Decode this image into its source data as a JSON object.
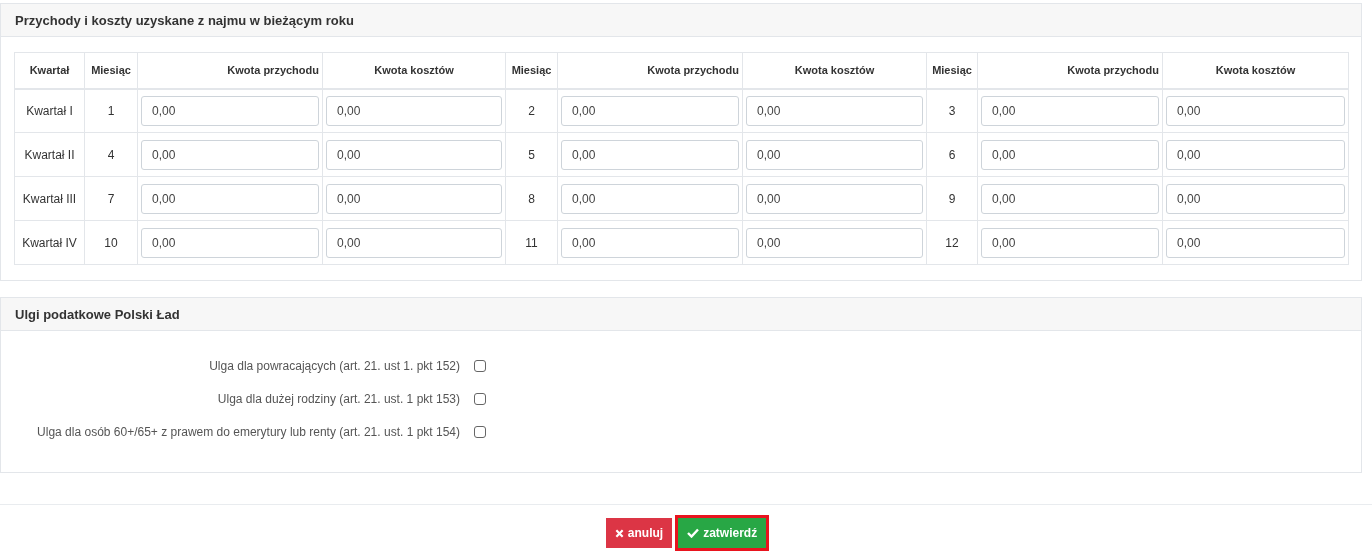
{
  "income_panel": {
    "title": "Przychody i koszty uzyskane z najmu w bieżącym roku",
    "columns": [
      "Kwartał",
      "Miesiąc",
      "Kwota przychodu",
      "Kwota kosztów",
      "Miesiąc",
      "Kwota przychodu",
      "Kwota kosztów",
      "Miesiąc",
      "Kwota przychodu",
      "Kwota kosztów"
    ],
    "rows": [
      {
        "quarter": "Kwartał I",
        "months": [
          {
            "month": "1",
            "income": "0,00",
            "costs": "0,00"
          },
          {
            "month": "2",
            "income": "0,00",
            "costs": "0,00"
          },
          {
            "month": "3",
            "income": "0,00",
            "costs": "0,00"
          }
        ]
      },
      {
        "quarter": "Kwartał II",
        "months": [
          {
            "month": "4",
            "income": "0,00",
            "costs": "0,00"
          },
          {
            "month": "5",
            "income": "0,00",
            "costs": "0,00"
          },
          {
            "month": "6",
            "income": "0,00",
            "costs": "0,00"
          }
        ]
      },
      {
        "quarter": "Kwartał III",
        "months": [
          {
            "month": "7",
            "income": "0,00",
            "costs": "0,00"
          },
          {
            "month": "8",
            "income": "0,00",
            "costs": "0,00"
          },
          {
            "month": "9",
            "income": "0,00",
            "costs": "0,00"
          }
        ]
      },
      {
        "quarter": "Kwartał IV",
        "months": [
          {
            "month": "10",
            "income": "0,00",
            "costs": "0,00"
          },
          {
            "month": "11",
            "income": "0,00",
            "costs": "0,00"
          },
          {
            "month": "12",
            "income": "0,00",
            "costs": "0,00"
          }
        ]
      }
    ]
  },
  "relief_panel": {
    "title": "Ulgi podatkowe Polski Ład",
    "options": [
      {
        "label": "Ulga dla powracających (art. 21. ust 1. pkt 152)",
        "checked": false
      },
      {
        "label": "Ulga dla dużej rodziny (art. 21. ust. 1 pkt 153)",
        "checked": false
      },
      {
        "label": "Ulga dla osób 60+/65+ z prawem do emerytury lub renty (art. 21. ust. 1 pkt 154)",
        "checked": false
      }
    ]
  },
  "buttons": [
    {
      "kind": "cancel",
      "label": "anuluj",
      "focused": false
    },
    {
      "kind": "confirm",
      "label": "zatwierdź",
      "focused": true
    }
  ]
}
